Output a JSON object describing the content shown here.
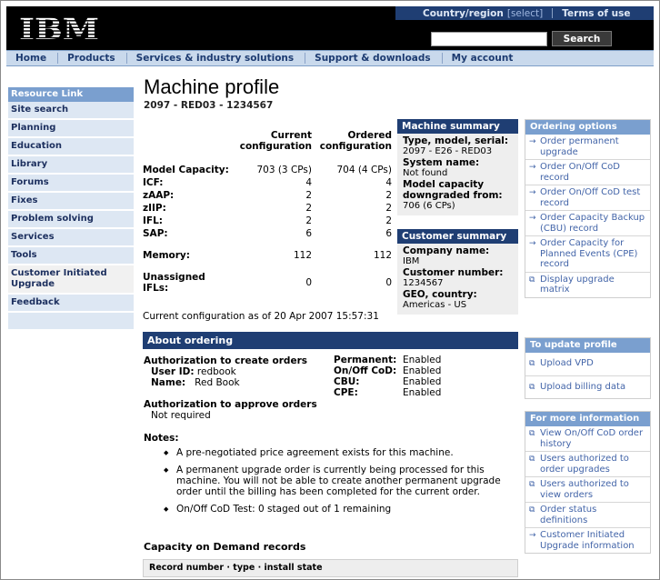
{
  "header": {
    "logo_text": "IBM",
    "top_links": [
      {
        "label": "Country/region",
        "suffix": "[select]"
      },
      {
        "label": "Terms of use"
      }
    ],
    "search_value": "",
    "search_button": "Search"
  },
  "mainnav": [
    "Home",
    "Products",
    "Services & industry solutions",
    "Support & downloads",
    "My account"
  ],
  "leftnav": {
    "heading": "Resource Link",
    "items": [
      "Site search",
      "Planning",
      "Education",
      "Library",
      "Forums",
      "Fixes",
      "Problem solving",
      "Services",
      "Tools",
      "Customer Initiated Upgrade",
      "Feedback"
    ]
  },
  "page": {
    "title": "Machine profile",
    "subtitle": "2097 - RED03 - 1234567"
  },
  "config": {
    "col_current": "Current configuration",
    "col_ordered": "Ordered configuration",
    "rows": [
      {
        "label": "Model Capacity:",
        "current": "703 (3 CPs)",
        "ordered": "704 (4 CPs)"
      },
      {
        "label": "ICF:",
        "current": "4",
        "ordered": "4"
      },
      {
        "label": "zAAP:",
        "current": "2",
        "ordered": "2"
      },
      {
        "label": "zIIP:",
        "current": "2",
        "ordered": "2"
      },
      {
        "label": "IFL:",
        "current": "2",
        "ordered": "2"
      },
      {
        "label": "SAP:",
        "current": "6",
        "ordered": "6"
      },
      {
        "label": "Memory:",
        "current": "112",
        "ordered": "112"
      },
      {
        "label": "Unassigned IFLs:",
        "current": "0",
        "ordered": "0"
      }
    ],
    "note": "Current configuration as of 20 Apr 2007 15:57:31"
  },
  "machine_summary": {
    "heading": "Machine summary",
    "fields": [
      {
        "key": "Type, model, serial:",
        "value": "2097 - E26 - RED03"
      },
      {
        "key": "System name:",
        "value": "Not found"
      },
      {
        "key": "Model capacity downgraded from:",
        "value": "706 (6 CPs)"
      }
    ]
  },
  "customer_summary": {
    "heading": "Customer summary",
    "fields": [
      {
        "key": "Company name:",
        "value": "IBM"
      },
      {
        "key": "Customer number:",
        "value": "1234567"
      },
      {
        "key": "GEO, country:",
        "value": "Americas - US"
      }
    ]
  },
  "about": {
    "heading": "About ordering",
    "create_heading": "Authorization to create orders",
    "user_id_label": "User ID:",
    "user_id": "redbook",
    "name_label": "Name:",
    "name": "Red Book",
    "perms": [
      {
        "key": "Permanent:",
        "value": "Enabled"
      },
      {
        "key": "On/Off CoD:",
        "value": "Enabled"
      },
      {
        "key": "CBU:",
        "value": "Enabled"
      },
      {
        "key": "CPE:",
        "value": "Enabled"
      }
    ],
    "approve_heading": "Authorization to approve orders",
    "approve_value": "Not required",
    "notes_heading": "Notes:",
    "notes": [
      "A pre-negotiated price agreement exists for this machine.",
      "A permanent upgrade order is currently being processed for this machine. You will not be able to create another permanent upgrade order until the billing has been completed for the current order.",
      "On/Off CoD Test: 0 staged out of 1 remaining"
    ]
  },
  "cod": {
    "heading": "Capacity on Demand records",
    "table_header": "Record number · type · install state"
  },
  "ordering_options": {
    "heading": "Ordering options",
    "links": [
      {
        "icon": "arrow",
        "label": "Order permanent upgrade"
      },
      {
        "icon": "arrow",
        "label": "Order On/Off CoD record"
      },
      {
        "icon": "arrow",
        "label": "Order On/Off CoD test record"
      },
      {
        "icon": "arrow",
        "label": "Order Capacity Backup (CBU) record"
      },
      {
        "icon": "arrow",
        "label": "Order Capacity for Planned Events (CPE) record"
      },
      {
        "icon": "popup",
        "label": "Display upgrade matrix"
      }
    ]
  },
  "update_profile": {
    "heading": "To update profile",
    "links": [
      {
        "icon": "popup",
        "label": "Upload VPD"
      },
      {
        "icon": "popup",
        "label": "Upload billing data"
      }
    ]
  },
  "more_info": {
    "heading": "For more information",
    "links": [
      {
        "icon": "popup",
        "label": "View On/Off CoD order history"
      },
      {
        "icon": "popup",
        "label": "Users authorized to order upgrades"
      },
      {
        "icon": "popup",
        "label": "Users authorized to view orders"
      },
      {
        "icon": "popup",
        "label": "Order status definitions"
      },
      {
        "icon": "arrow",
        "label": "Customer Initiated Upgrade information"
      }
    ]
  }
}
